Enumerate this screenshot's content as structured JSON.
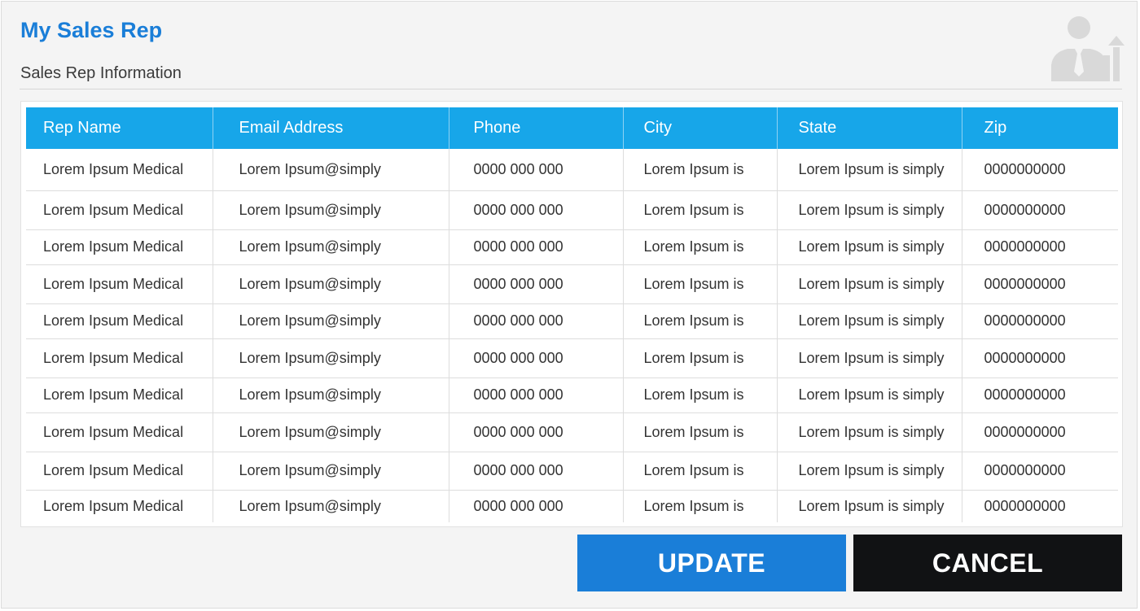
{
  "page": {
    "title": "My Sales Rep",
    "subtitle": "Sales Rep Information",
    "icon": "sales-rep-growth-icon"
  },
  "colors": {
    "title": "#1a7ed8",
    "table_header": "#17a6e9",
    "update_button": "#1a7ed8",
    "cancel_button": "#111214"
  },
  "table": {
    "columns": [
      "Rep Name",
      "Email Address",
      "Phone",
      "City",
      "State",
      "Zip"
    ],
    "rows": [
      [
        "Lorem Ipsum Medical",
        "Lorem Ipsum@simply",
        "0000 000 000",
        "Lorem Ipsum is",
        "Lorem Ipsum is simply",
        "0000000000"
      ],
      [
        "Lorem Ipsum Medical",
        "Lorem Ipsum@simply",
        "0000 000 000",
        "Lorem Ipsum is",
        "Lorem Ipsum is simply",
        "0000000000"
      ],
      [
        "Lorem Ipsum Medical",
        "Lorem Ipsum@simply",
        "0000 000 000",
        "Lorem Ipsum is",
        "Lorem Ipsum is simply",
        "0000000000"
      ],
      [
        "Lorem Ipsum Medical",
        "Lorem Ipsum@simply",
        "0000 000 000",
        "Lorem Ipsum is",
        "Lorem Ipsum is simply",
        "0000000000"
      ],
      [
        "Lorem Ipsum Medical",
        "Lorem Ipsum@simply",
        "0000 000 000",
        "Lorem Ipsum is",
        "Lorem Ipsum is simply",
        "0000000000"
      ],
      [
        "Lorem Ipsum Medical",
        "Lorem Ipsum@simply",
        "0000 000 000",
        "Lorem Ipsum is",
        "Lorem Ipsum is simply",
        "0000000000"
      ],
      [
        "Lorem Ipsum Medical",
        "Lorem Ipsum@simply",
        "0000 000 000",
        "Lorem Ipsum is",
        "Lorem Ipsum is simply",
        "0000000000"
      ],
      [
        "Lorem Ipsum Medical",
        "Lorem Ipsum@simply",
        "0000 000 000",
        "Lorem Ipsum is",
        "Lorem Ipsum is simply",
        "0000000000"
      ],
      [
        "Lorem Ipsum Medical",
        "Lorem Ipsum@simply",
        "0000 000 000",
        "Lorem Ipsum is",
        "Lorem Ipsum is simply",
        "0000000000"
      ],
      [
        "Lorem Ipsum Medical",
        "Lorem Ipsum@simply",
        "0000 000 000",
        "Lorem Ipsum is",
        "Lorem Ipsum is simply",
        "0000000000"
      ]
    ]
  },
  "buttons": {
    "update": "UPDATE",
    "cancel": "CANCEL"
  }
}
